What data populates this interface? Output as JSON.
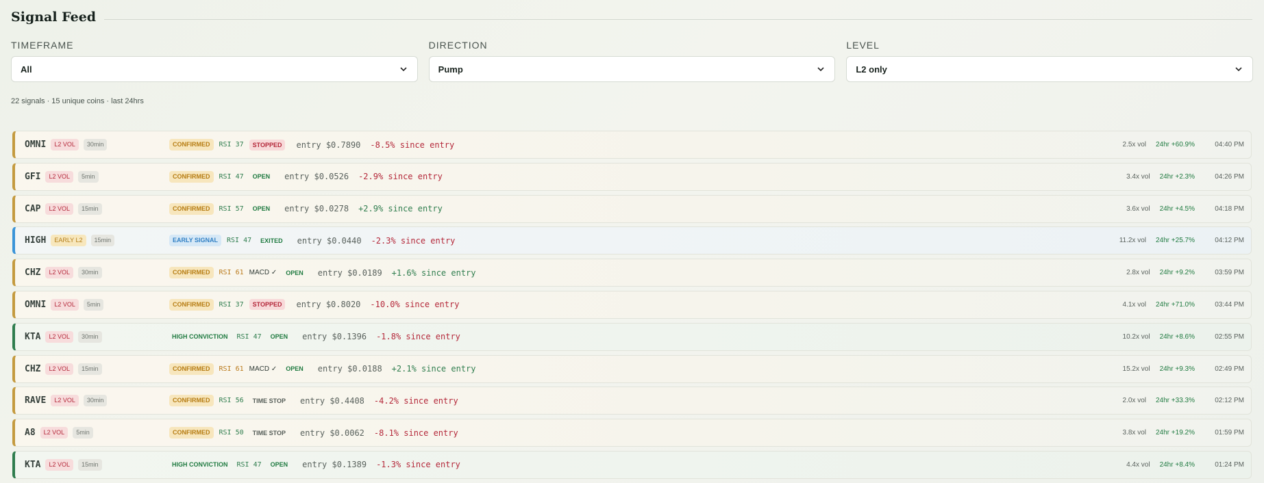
{
  "page": {
    "title": "Signal Feed"
  },
  "filters": [
    {
      "label": "TIMEFRAME",
      "value": "All"
    },
    {
      "label": "DIRECTION",
      "value": "Pump"
    },
    {
      "label": "LEVEL",
      "value": "L2 only"
    }
  ],
  "summary": "22 signals · 15 unique coins · last 24hrs",
  "colors": {
    "accent_confirmed": "#c49a3f",
    "accent_early": "#3a94d8",
    "accent_high_conviction": "#2f7d4e",
    "negative": "#b4283a",
    "positive": "#2f7d4e"
  },
  "signals": [
    {
      "coin": "OMNI",
      "level": "L2 VOL",
      "timeframe": "30min",
      "signal": "CONFIRMED",
      "rsi": "RSI 37",
      "macd": "",
      "status": "STOPPED",
      "entry": "entry $0.7890",
      "change": "-8.5% since entry",
      "volume": "2.5x vol",
      "change_24h": "24hr +60.9%",
      "time": "04:40 PM"
    },
    {
      "coin": "GFI",
      "level": "L2 VOL",
      "timeframe": "5min",
      "signal": "CONFIRMED",
      "rsi": "RSI 47",
      "macd": "",
      "status": "OPEN",
      "entry": "entry $0.0526",
      "change": "-2.9% since entry",
      "volume": "3.4x vol",
      "change_24h": "24hr +2.3%",
      "time": "04:26 PM"
    },
    {
      "coin": "CAP",
      "level": "L2 VOL",
      "timeframe": "15min",
      "signal": "CONFIRMED",
      "rsi": "RSI 57",
      "macd": "",
      "status": "OPEN",
      "entry": "entry $0.0278",
      "change": "+2.9% since entry",
      "volume": "3.6x vol",
      "change_24h": "24hr +4.5%",
      "time": "04:18 PM"
    },
    {
      "coin": "HIGH",
      "level": "EARLY L2",
      "timeframe": "15min",
      "signal": "EARLY SIGNAL",
      "rsi": "RSI 47",
      "macd": "",
      "status": "EXITED",
      "entry": "entry $0.0440",
      "change": "-2.3% since entry",
      "volume": "11.2x vol",
      "change_24h": "24hr +25.7%",
      "time": "04:12 PM"
    },
    {
      "coin": "CHZ",
      "level": "L2 VOL",
      "timeframe": "30min",
      "signal": "CONFIRMED",
      "rsi": "RSI 61",
      "macd": "MACD ✓",
      "status": "OPEN",
      "entry": "entry $0.0189",
      "change": "+1.6% since entry",
      "volume": "2.8x vol",
      "change_24h": "24hr +9.2%",
      "time": "03:59 PM"
    },
    {
      "coin": "OMNI",
      "level": "L2 VOL",
      "timeframe": "5min",
      "signal": "CONFIRMED",
      "rsi": "RSI 37",
      "macd": "",
      "status": "STOPPED",
      "entry": "entry $0.8020",
      "change": "-10.0% since entry",
      "volume": "4.1x vol",
      "change_24h": "24hr +71.0%",
      "time": "03:44 PM"
    },
    {
      "coin": "KTA",
      "level": "L2 VOL",
      "timeframe": "30min",
      "signal": "HIGH CONVICTION",
      "rsi": "RSI 47",
      "macd": "",
      "status": "OPEN",
      "entry": "entry $0.1396",
      "change": "-1.8% since entry",
      "volume": "10.2x vol",
      "change_24h": "24hr +8.6%",
      "time": "02:55 PM"
    },
    {
      "coin": "CHZ",
      "level": "L2 VOL",
      "timeframe": "15min",
      "signal": "CONFIRMED",
      "rsi": "RSI 61",
      "macd": "MACD ✓",
      "status": "OPEN",
      "entry": "entry $0.0188",
      "change": "+2.1% since entry",
      "volume": "15.2x vol",
      "change_24h": "24hr +9.3%",
      "time": "02:49 PM"
    },
    {
      "coin": "RAVE",
      "level": "L2 VOL",
      "timeframe": "30min",
      "signal": "CONFIRMED",
      "rsi": "RSI 56",
      "macd": "",
      "status": "TIME STOP",
      "entry": "entry $0.4408",
      "change": "-4.2% since entry",
      "volume": "2.0x vol",
      "change_24h": "24hr +33.3%",
      "time": "02:12 PM"
    },
    {
      "coin": "A8",
      "level": "L2 VOL",
      "timeframe": "5min",
      "signal": "CONFIRMED",
      "rsi": "RSI 50",
      "macd": "",
      "status": "TIME STOP",
      "entry": "entry $0.0062",
      "change": "-8.1% since entry",
      "volume": "3.8x vol",
      "change_24h": "24hr +19.2%",
      "time": "01:59 PM"
    },
    {
      "coin": "KTA",
      "level": "L2 VOL",
      "timeframe": "15min",
      "signal": "HIGH CONVICTION",
      "rsi": "RSI 47",
      "macd": "",
      "status": "OPEN",
      "entry": "entry $0.1389",
      "change": "-1.3% since entry",
      "volume": "4.4x vol",
      "change_24h": "24hr +8.4%",
      "time": "01:24 PM"
    }
  ]
}
